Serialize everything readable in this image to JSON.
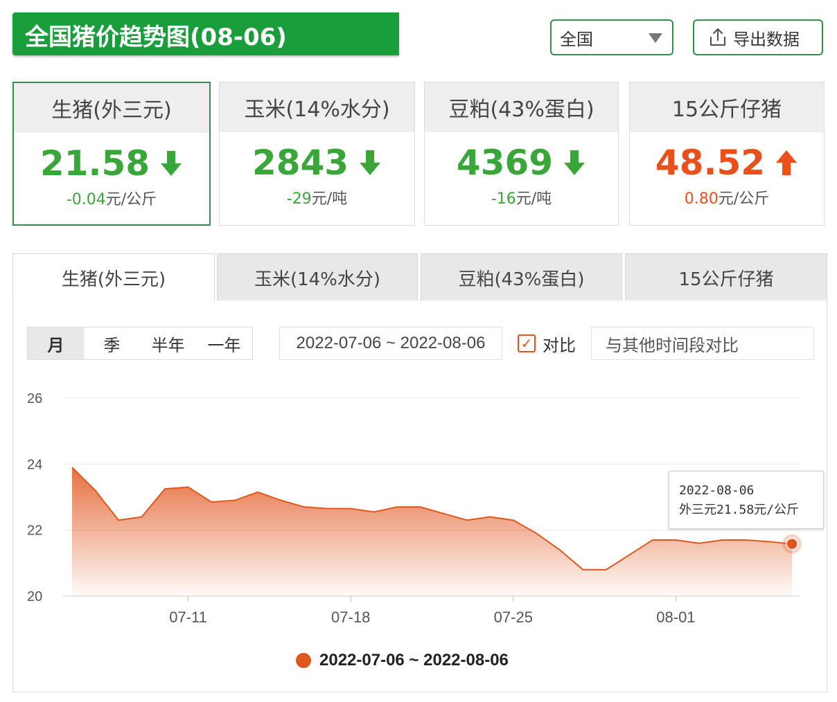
{
  "header": {
    "title": "全国猪价趋势图(08-06)",
    "region": "全国",
    "export_label": "导出数据"
  },
  "cards": [
    {
      "name": "生猪(外三元)",
      "value": "21.58",
      "direction": "down",
      "change": "-0.04",
      "unit": "元/公斤"
    },
    {
      "name": "玉米(14%水分)",
      "value": "2843",
      "direction": "down",
      "change": "-29",
      "unit": "元/吨"
    },
    {
      "name": "豆粕(43%蛋白)",
      "value": "4369",
      "direction": "down",
      "change": "-16",
      "unit": "元/吨"
    },
    {
      "name": "15公斤仔猪",
      "value": "48.52",
      "direction": "up",
      "change": "0.80",
      "unit": "元/公斤"
    }
  ],
  "tabs": [
    "生猪(外三元)",
    "玉米(14%水分)",
    "豆粕(43%蛋白)",
    "15公斤仔猪"
  ],
  "range_buttons": [
    "月",
    "季",
    "半年",
    "一年"
  ],
  "date_range": "2022-07-06 ~ 2022-08-06",
  "compare": {
    "label": "对比",
    "checked": true,
    "placeholder": "与其他时间段对比"
  },
  "tooltip": {
    "date": "2022-08-06",
    "text": "外三元21.58元/公斤"
  },
  "legend": "2022-07-06 ~ 2022-08-06",
  "colors": {
    "green": "#3aa63a",
    "orange": "#e8501c",
    "brand": "#1a9e3c"
  },
  "chart_data": {
    "type": "area",
    "x": [
      "07-06",
      "07-07",
      "07-08",
      "07-09",
      "07-10",
      "07-11",
      "07-12",
      "07-13",
      "07-14",
      "07-15",
      "07-16",
      "07-17",
      "07-18",
      "07-19",
      "07-20",
      "07-21",
      "07-22",
      "07-23",
      "07-24",
      "07-25",
      "07-26",
      "07-27",
      "07-28",
      "07-29",
      "07-30",
      "07-31",
      "08-01",
      "08-02",
      "08-03",
      "08-04",
      "08-05",
      "08-06"
    ],
    "series": [
      {
        "name": "2022-07-06 ~ 2022-08-06",
        "values": [
          23.9,
          23.2,
          22.3,
          22.4,
          23.25,
          23.3,
          22.85,
          22.9,
          23.15,
          22.9,
          22.7,
          22.65,
          22.65,
          22.55,
          22.7,
          22.7,
          22.5,
          22.3,
          22.4,
          22.3,
          21.9,
          21.4,
          20.8,
          20.8,
          21.25,
          21.7,
          21.7,
          21.6,
          21.7,
          21.7,
          21.65,
          21.58
        ]
      }
    ],
    "xticks": [
      "07-11",
      "07-18",
      "07-25",
      "08-01"
    ],
    "yticks": [
      20,
      22,
      24,
      26
    ],
    "ylim": [
      20,
      26
    ],
    "grid": true,
    "legend_position": "bottom-center"
  }
}
